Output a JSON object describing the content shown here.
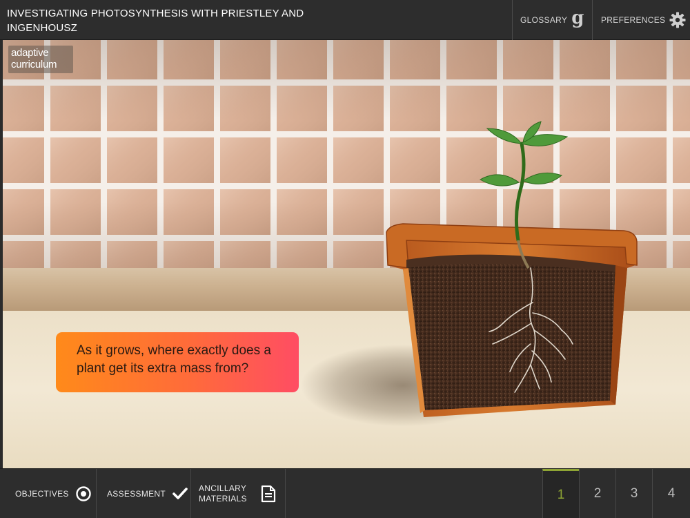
{
  "header": {
    "title": "INVESTIGATING PHOTOSYNTHESIS WITH PRIESTLEY AND INGENHOUSZ",
    "glossary_label": "GLOSSARY",
    "glossary_icon": "g",
    "preferences_label": "PREFERENCES"
  },
  "logo": {
    "line1": "adaptive",
    "line2": "curriculum"
  },
  "scene": {
    "question": "As it grows, where exactly does a plant get its extra mass from?"
  },
  "footer": {
    "objectives_label": "OBJECTIVES",
    "assessment_label": "ASSESSMENT",
    "ancillary_label": "ANCILLARY MATERIALS",
    "pages": [
      "1",
      "2",
      "3",
      "4"
    ],
    "active_page": "1"
  },
  "colors": {
    "accent": "#8ea434",
    "bar_bg": "#2d2d2d",
    "question_gradient_start": "#ff8a1a",
    "question_gradient_end": "#ff4d63"
  },
  "icons": {
    "glossary": "glossary-g-icon",
    "preferences": "gear-icon",
    "objectives": "target-icon",
    "assessment": "checkmark-icon",
    "ancillary": "document-icon"
  }
}
